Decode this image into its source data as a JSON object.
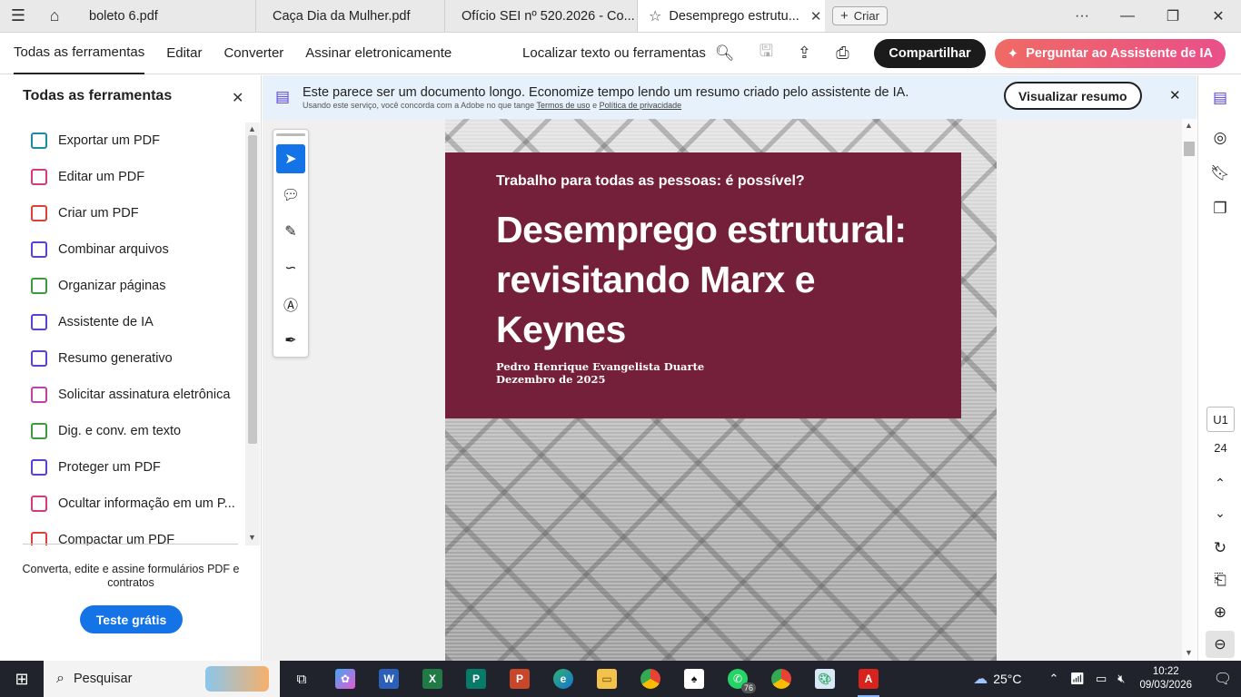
{
  "tabs": [
    {
      "title": "boleto 6.pdf",
      "active": false
    },
    {
      "title": "Caça Dia da Mulher.pdf",
      "active": false
    },
    {
      "title": "Ofício SEI nº 520.2026 - Co...",
      "active": false
    },
    {
      "title": "Desemprego estrutu...",
      "active": true
    }
  ],
  "new_tab_label": "Criar",
  "window_controls": {
    "more": "···",
    "minimize": "—",
    "maximize": "❐",
    "close": "✕"
  },
  "toolbar": {
    "menu": [
      "Todas as ferramentas",
      "Editar",
      "Converter",
      "Assinar eletronicamente"
    ],
    "find_label": "Localizar texto ou ferramentas",
    "share_label": "Compartilhar",
    "ai_label": "Perguntar ao Assistente de IA"
  },
  "left_panel": {
    "title": "Todas as ferramentas",
    "items": [
      {
        "label": "Exportar um PDF",
        "color": "#1a8ca0",
        "icon": "export-pdf-icon"
      },
      {
        "label": "Editar um PDF",
        "color": "#d63a7e",
        "icon": "edit-pdf-icon"
      },
      {
        "label": "Criar um PDF",
        "color": "#e0403a",
        "icon": "create-pdf-icon"
      },
      {
        "label": "Combinar arquivos",
        "color": "#5a3fd0",
        "icon": "combine-files-icon"
      },
      {
        "label": "Organizar páginas",
        "color": "#3a9b3a",
        "icon": "organize-pages-icon"
      },
      {
        "label": "Assistente de IA",
        "color": "#5a3fd0",
        "icon": "ai-assistant-icon"
      },
      {
        "label": "Resumo generativo",
        "color": "#5a3fd0",
        "icon": "generative-summary-icon"
      },
      {
        "label": "Solicitar assinatura eletrônica",
        "color": "#c33fa8",
        "icon": "request-signature-icon"
      },
      {
        "label": "Dig. e conv. em texto",
        "color": "#3a9b3a",
        "icon": "scan-ocr-icon"
      },
      {
        "label": "Proteger um PDF",
        "color": "#5a3fd0",
        "icon": "protect-pdf-icon"
      },
      {
        "label": "Ocultar informação em um P...",
        "color": "#d63a7e",
        "icon": "redact-icon"
      },
      {
        "label": "Compactar um PDF",
        "color": "#e0403a",
        "icon": "compress-pdf-icon"
      }
    ],
    "promo_text": "Converta, edite e assine formulários PDF e contratos",
    "trial_label": "Teste grátis"
  },
  "banner": {
    "message": "Este parece ser um documento longo. Economize tempo lendo um resumo criado pelo assistente de IA.",
    "sub_prefix": "Usando este serviço, você concorda com a Adobe no que tange",
    "terms_link": "Termos de uso",
    "sub_and": "e",
    "privacy_link": "Política de privacidade",
    "button_label": "Visualizar resumo"
  },
  "document": {
    "kicker": "Trabalho para todas as pessoas: é possível?",
    "title": "Desemprego estrutural: revisitando Marx e Keynes",
    "author": "Pedro Henrique Evangelista Duarte",
    "date": "Dezembro de 2025"
  },
  "navigation": {
    "page_current": "U1",
    "page_total": "24"
  },
  "taskbar": {
    "search_placeholder": "Pesquisar",
    "whatsapp_badge": "76",
    "weather_temp": "25°C",
    "time": "10:22",
    "date": "09/03/2026"
  },
  "colors": {
    "accent_blue": "#1473e6",
    "cover_maroon": "#74203a",
    "ai_gradient_start": "#f06a64",
    "ai_gradient_end": "#ea4f8a"
  }
}
